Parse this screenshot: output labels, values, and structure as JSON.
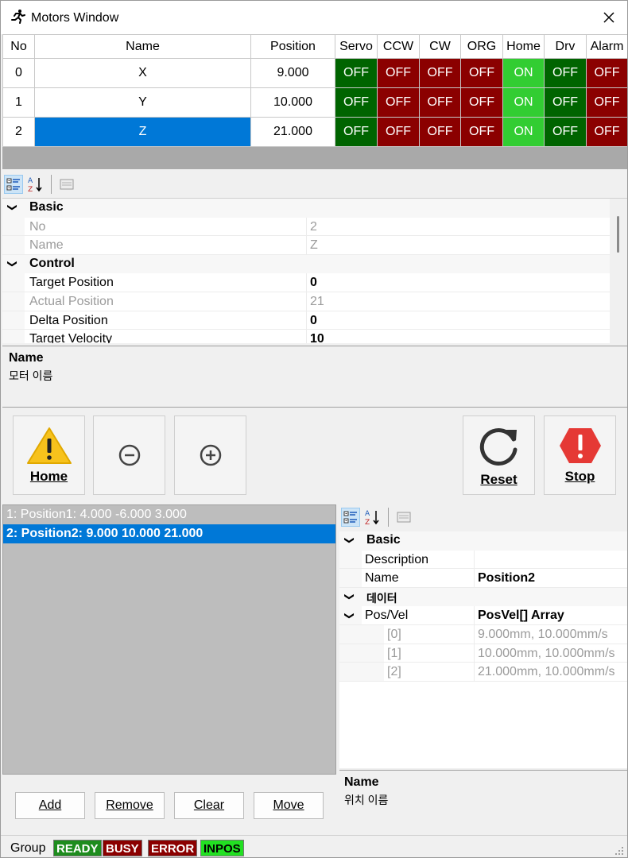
{
  "window": {
    "title": "Motors Window"
  },
  "motor_grid": {
    "columns": [
      "No",
      "Name",
      "Position",
      "Servo",
      "CCW",
      "CW",
      "ORG",
      "Home",
      "Drv",
      "Alarm"
    ],
    "rows": [
      {
        "no": "0",
        "name": "X",
        "position": "9.000",
        "servo": "OFF",
        "ccw": "OFF",
        "cw": "OFF",
        "org": "OFF",
        "home": "ON",
        "drv": "OFF",
        "alarm": "OFF"
      },
      {
        "no": "1",
        "name": "Y",
        "position": "10.000",
        "servo": "OFF",
        "ccw": "OFF",
        "cw": "OFF",
        "org": "OFF",
        "home": "ON",
        "drv": "OFF",
        "alarm": "OFF"
      },
      {
        "no": "2",
        "name": "Z",
        "position": "21.000",
        "servo": "OFF",
        "ccw": "OFF",
        "cw": "OFF",
        "org": "OFF",
        "home": "ON",
        "drv": "OFF",
        "alarm": "OFF"
      }
    ],
    "colors": {
      "off_green": "#006400",
      "off_red": "#8b0000",
      "on": "#32cd32",
      "selection": "#0078d7"
    }
  },
  "motor_props": {
    "cat_basic": "Basic",
    "no_label": "No",
    "no_value": "2",
    "name_label": "Name",
    "name_value": "Z",
    "cat_control": "Control",
    "target_pos_label": "Target Position",
    "target_pos_value": "0",
    "actual_pos_label": "Actual Position",
    "actual_pos_value": "21",
    "delta_pos_label": "Delta Position",
    "delta_pos_value": "0",
    "target_vel_label": "Target Velocity",
    "target_vel_value": "10"
  },
  "motor_desc": {
    "title": "Name",
    "text": "모터 이름"
  },
  "actions": {
    "home": "Home",
    "reset": "Reset",
    "stop": "Stop"
  },
  "positions": {
    "items": [
      "1: Position1: 4.000 -6.000 3.000",
      "2: Position2: 9.000 10.000 21.000"
    ]
  },
  "pos_props": {
    "cat_basic": "Basic",
    "description_label": "Description",
    "description_value": "",
    "name_label": "Name",
    "name_value": "Position2",
    "cat_data": "데이터",
    "posvel_label": "Pos/Vel",
    "posvel_value": "PosVel[] Array",
    "entries": [
      {
        "index": "[0]",
        "value": "9.000mm, 10.000mm/s"
      },
      {
        "index": "[1]",
        "value": "10.000mm, 10.000mm/s"
      },
      {
        "index": "[2]",
        "value": "21.000mm, 10.000mm/s"
      }
    ]
  },
  "pos_desc": {
    "title": "Name",
    "text": "위치 이름"
  },
  "list_buttons": {
    "add": "Add",
    "remove": "Remove",
    "clear": "Clear",
    "move": "Move"
  },
  "status": {
    "label": "Group",
    "badges": [
      {
        "text": "READY",
        "bg": "#1e8c1e",
        "fg": "#ffffff"
      },
      {
        "text": "BUSY",
        "bg": "#8b0000",
        "fg": "#ffffff"
      },
      {
        "text": "ERROR",
        "bg": "#8b0000",
        "fg": "#ffffff"
      },
      {
        "text": "INPOS",
        "bg": "#22e022",
        "fg": "#000000"
      }
    ]
  }
}
